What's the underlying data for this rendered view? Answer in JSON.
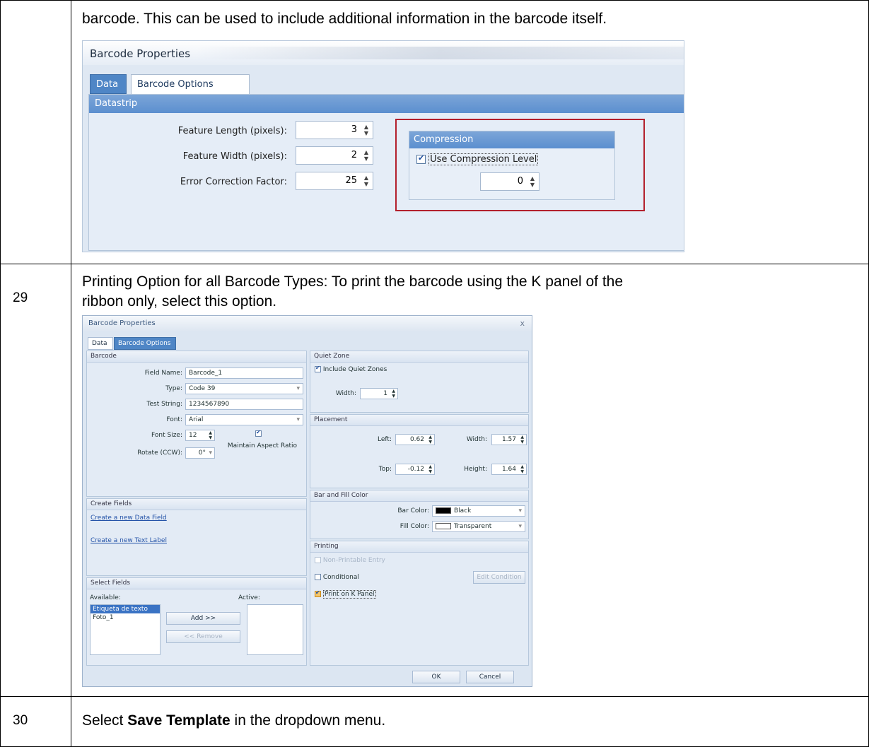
{
  "rows": [
    {
      "number": "",
      "text": "barcode. This can be used to include additional information in the barcode itself."
    },
    {
      "number": "29",
      "text_line1": "Printing Option for all Barcode Types:  To print the barcode using the K panel of the",
      "text_line2": "ribbon only, select this option."
    },
    {
      "number": "30",
      "text_before": "Select ",
      "text_bold": "Save Template",
      "text_after": " in the dropdown menu."
    }
  ],
  "dialog1": {
    "title": "Barcode Properties",
    "tabs": [
      "Data",
      "Barcode Options"
    ],
    "section": "Datastrip",
    "fields": [
      {
        "label": "Feature Length (pixels):",
        "value": "3"
      },
      {
        "label": "Feature Width (pixels):",
        "value": "2"
      },
      {
        "label": "Error Correction Factor:",
        "value": "25"
      }
    ],
    "compression": {
      "header": "Compression",
      "checkbox_label": "Use Compression Level",
      "checked": true,
      "value": "0"
    }
  },
  "dialog2": {
    "title": "Barcode Properties",
    "close": "x",
    "tabs": [
      "Data",
      "Barcode Options"
    ],
    "barcode": {
      "header": "Barcode",
      "field_name_label": "Field Name:",
      "field_name": "Barcode_1",
      "type_label": "Type:",
      "type": "Code 39",
      "test_string_label": "Test String:",
      "test_string": "1234567890",
      "font_label": "Font:",
      "font": "Arial",
      "font_size_label": "Font Size:",
      "font_size": "12",
      "rotate_label": "Rotate (CCW):",
      "rotate": "0°",
      "aspect_label": "Maintain Aspect Ratio"
    },
    "quiet_zone": {
      "header": "Quiet Zone",
      "include_label": "Include Quiet Zones",
      "width_label": "Width:",
      "width": "1"
    },
    "placement": {
      "header": "Placement",
      "left_label": "Left:",
      "left": "0.62",
      "width_label": "Width:",
      "width": "1.57",
      "top_label": "Top:",
      "top": "-0.12",
      "height_label": "Height:",
      "height": "1.64"
    },
    "color": {
      "header": "Bar and Fill Color",
      "bar_label": "Bar Color:",
      "bar": "Black",
      "bar_hex": "#000000",
      "fill_label": "Fill Color:",
      "fill": "Transparent",
      "fill_hex": "#ffffff"
    },
    "create_fields": {
      "header": "Create Fields",
      "link1": "Create a new Data Field",
      "link2": "Create a new Text Label"
    },
    "printing": {
      "header": "Printing",
      "non_printable": "Non-Printable Entry",
      "conditional": "Conditional",
      "edit_condition": "Edit Condition",
      "print_k": "Print on K Panel"
    },
    "select_fields": {
      "header": "Select Fields",
      "available_label": "Available:",
      "active_label": "Active:",
      "available": [
        "Etiqueta de texto",
        "Foto_1"
      ],
      "add": "Add >>",
      "remove": "<< Remove"
    },
    "ok": "OK",
    "cancel": "Cancel"
  }
}
